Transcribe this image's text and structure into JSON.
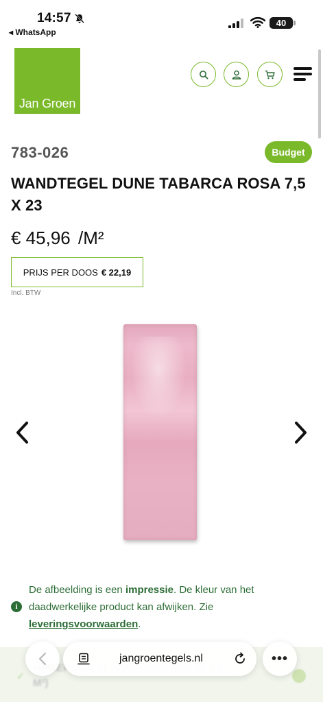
{
  "status_bar": {
    "time": "14:57",
    "back_app": "◂ WhatsApp",
    "battery": "40"
  },
  "header": {
    "logo_text": "Jan Groen",
    "icons": [
      "search-icon",
      "user-icon",
      "cart-icon",
      "menu-icon"
    ],
    "accent_color": "#7ab929"
  },
  "product": {
    "sku": "783-026",
    "badge": "Budget",
    "title": "WANDTEGEL DUNE TABARCA ROSA 7,5 X 23",
    "price": "€ 45,96",
    "price_unit": "/M²",
    "box_price_label": "PRIJS PER DOOS",
    "box_price_value": "€ 22,19",
    "vat_note": "Incl. BTW",
    "tile_color": "#e9b2c4"
  },
  "note": {
    "part1": "De afbeelding is een ",
    "bold": "impressie",
    "part2": ". De kleur van het daadwerkelijke product kan afwijken. Zie ",
    "link": "leveringsvoorwaarden",
    "part3": ".",
    "color": "#2d6d36"
  },
  "sticky_bar": {
    "line1": "OPBERGEN IN WINKELWAGEN (€ 7,9",
    "line2": "M²)"
  },
  "browser": {
    "url": "jangroentegels.nl",
    "more": "•••"
  }
}
